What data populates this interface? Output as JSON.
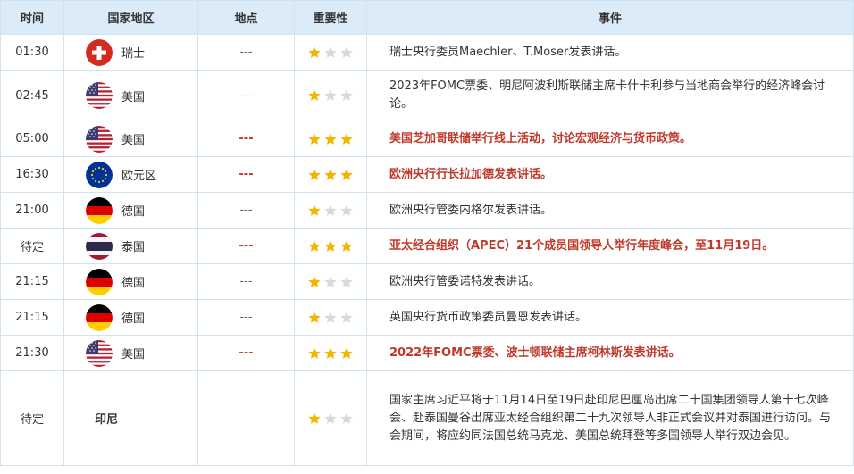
{
  "header": {
    "time": "时间",
    "country": "国家地区",
    "location": "地点",
    "importance": "重要性",
    "event": "事件"
  },
  "rows": [
    {
      "time": "01:30",
      "flag": "switzerland",
      "country": "瑞士",
      "location": "---",
      "stars": 1,
      "event": "瑞士央行委员Maechler、T.Moser发表讲话。",
      "highlight": false
    },
    {
      "time": "02:45",
      "flag": "usa",
      "country": "美国",
      "location": "---",
      "stars": 1,
      "event": "2023年FOMC票委、明尼阿波利斯联储主席卡什卡利参与当地商会举行的经济峰会讨论。",
      "highlight": false
    },
    {
      "time": "05:00",
      "flag": "usa",
      "country": "美国",
      "location": "---",
      "stars": 3,
      "event": "美国芝加哥联储举行线上活动，讨论宏观经济与货币政策。",
      "highlight": true
    },
    {
      "time": "16:30",
      "flag": "eu",
      "country": "欧元区",
      "location": "---",
      "stars": 3,
      "event": "欧洲央行行长拉加德发表讲话。",
      "highlight": true
    },
    {
      "time": "21:00",
      "flag": "germany",
      "country": "德国",
      "location": "---",
      "stars": 1,
      "event": "欧洲央行管委内格尔发表讲话。",
      "highlight": false
    },
    {
      "time": "待定",
      "flag": "thailand",
      "country": "泰国",
      "location": "---",
      "stars": 3,
      "event": "亚太经合组织（APEC）21个成员国领导人举行年度峰会，至11月19日。",
      "highlight": true
    },
    {
      "time": "21:15",
      "flag": "germany",
      "country": "德国",
      "location": "---",
      "stars": 1,
      "event": "欧洲央行管委诺特发表讲话。",
      "highlight": false
    },
    {
      "time": "21:15",
      "flag": "germany",
      "country": "德国",
      "location": "---",
      "stars": 1,
      "event": "英国央行货币政策委员曼恩发表讲话。",
      "highlight": false
    },
    {
      "time": "21:30",
      "flag": "usa",
      "country": "美国",
      "location": "---",
      "stars": 3,
      "event": "2022年FOMC票委、波士顿联储主席柯林斯发表讲话。",
      "highlight": true
    },
    {
      "time": "待定",
      "flag": "none",
      "country": "印尼",
      "location": "",
      "stars": 1,
      "event": "国家主席习近平将于11月14日至19日赴印尼巴厘岛出席二十国集团领导人第十七次峰会、赴泰国曼谷出席亚太经合组织第二十九次领导人非正式会议并对泰国进行访问。与会期间，将应约同法国总统马克龙、美国总统拜登等多国领导人举行双边会见。",
      "highlight": false
    }
  ],
  "colors": {
    "highlight_text": "#c0392b",
    "header_bg": "#dcebf8",
    "border": "#cfe3f3",
    "star_on": "#f5b400",
    "star_off": "#d9d9d9"
  }
}
